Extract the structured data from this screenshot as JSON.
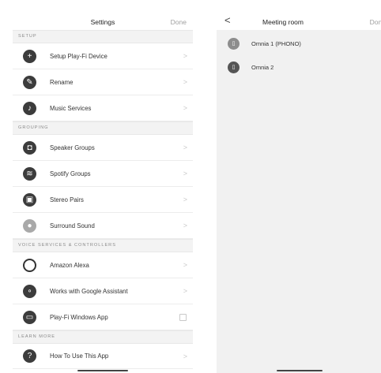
{
  "left": {
    "title": "Settings",
    "done": "Done",
    "sections": {
      "setup": "SETUP",
      "grouping": "GROUPING",
      "voice": "VOICE SERVICES & CONTROLLERS",
      "learn": "LEARN MORE"
    },
    "items": {
      "setup_device": "Setup Play-Fi Device",
      "rename": "Rename",
      "music_services": "Music Services",
      "speaker_groups": "Speaker Groups",
      "spotify_groups": "Spotify Groups",
      "stereo_pairs": "Stereo Pairs",
      "surround_sound": "Surround Sound",
      "amazon_alexa": "Amazon Alexa",
      "google_assistant": "Works with Google Assistant",
      "windows_app": "Play-Fi Windows App",
      "how_to": "How To Use This App"
    },
    "icons": {
      "setup_device": "plus-icon",
      "rename": "pencil-icon",
      "music_services": "music-note-icon",
      "speaker_groups": "speaker-group-icon",
      "spotify_groups": "spotify-icon",
      "stereo_pairs": "stereo-pair-icon",
      "surround_sound": "surround-icon",
      "amazon_alexa": "alexa-icon",
      "google_assistant": "google-assistant-icon",
      "windows_app": "laptop-icon",
      "how_to": "help-icon"
    }
  },
  "right": {
    "back": "<",
    "title": "Meeting room",
    "done": "Done",
    "devices": [
      "Omnia 1 (PHONO)",
      "Omnia 2"
    ]
  },
  "colors": {
    "section_bg": "#f3f3f3",
    "right_bg": "#f1f1f1",
    "icon": "#3c3c3c"
  }
}
